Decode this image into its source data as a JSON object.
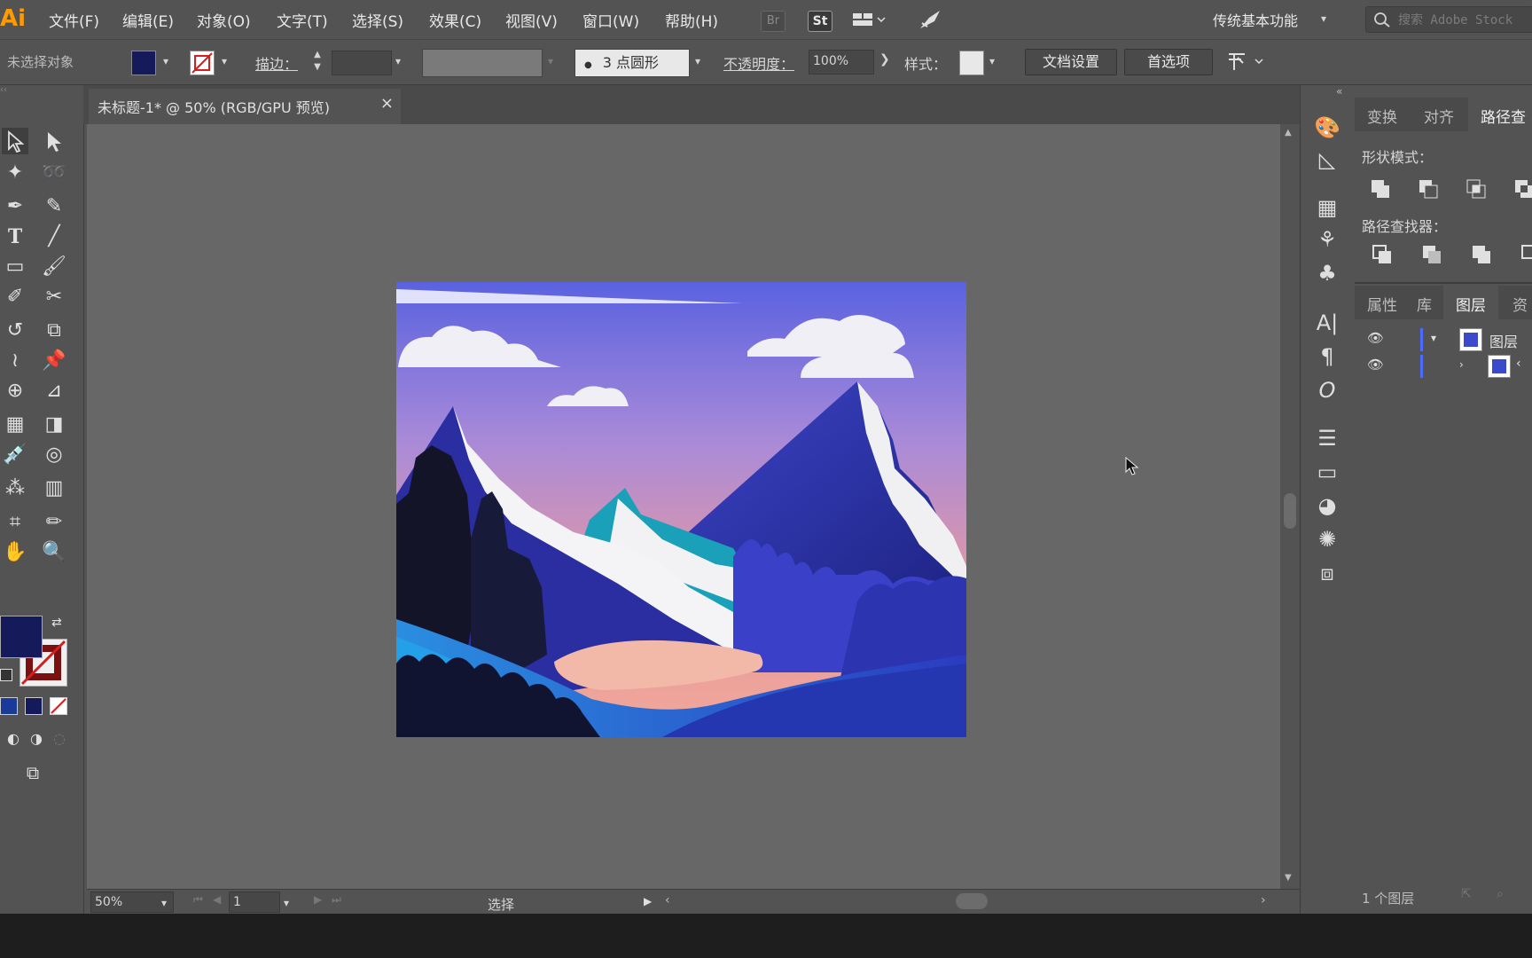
{
  "app": {
    "logo": "Ai"
  },
  "menu": [
    "文件(F)",
    "编辑(E)",
    "对象(O)",
    "文字(T)",
    "选择(S)",
    "效果(C)",
    "视图(V)",
    "窗口(W)",
    "帮助(H)"
  ],
  "topbar": {
    "br_label": "Br",
    "st_label": "St",
    "workspace": "传统基本功能",
    "search_placeholder": "搜索 Adobe Stock"
  },
  "control": {
    "selection_state": "未选择对象",
    "fill_color": "#141a5a",
    "stroke_label": "描边：",
    "brush_label": "3 点圆形",
    "opacity_label": "不透明度：",
    "opacity_value": "100%",
    "style_label": "样式：",
    "doc_setup": "文档设置",
    "preferences": "首选项"
  },
  "document": {
    "tab_title": "未标题-1* @ 50% (RGB/GPU 预览)"
  },
  "status": {
    "zoom": "50%",
    "page": "1",
    "tool": "选择"
  },
  "panels": {
    "top_tabs": [
      "变换",
      "对齐",
      "路径查"
    ],
    "shape_modes_label": "形状模式：",
    "pathfinder_label": "路径查找器：",
    "bottom_tabs": [
      "属性",
      "库",
      "图层",
      "资"
    ],
    "layer_name": "图层",
    "layer_count": "1 个图层"
  },
  "colors": {
    "accent": "#ff9a00",
    "fill": "#141a5a",
    "stroke_none": "#d22020",
    "ui_bg": "#535353",
    "canvas": "#676767"
  }
}
